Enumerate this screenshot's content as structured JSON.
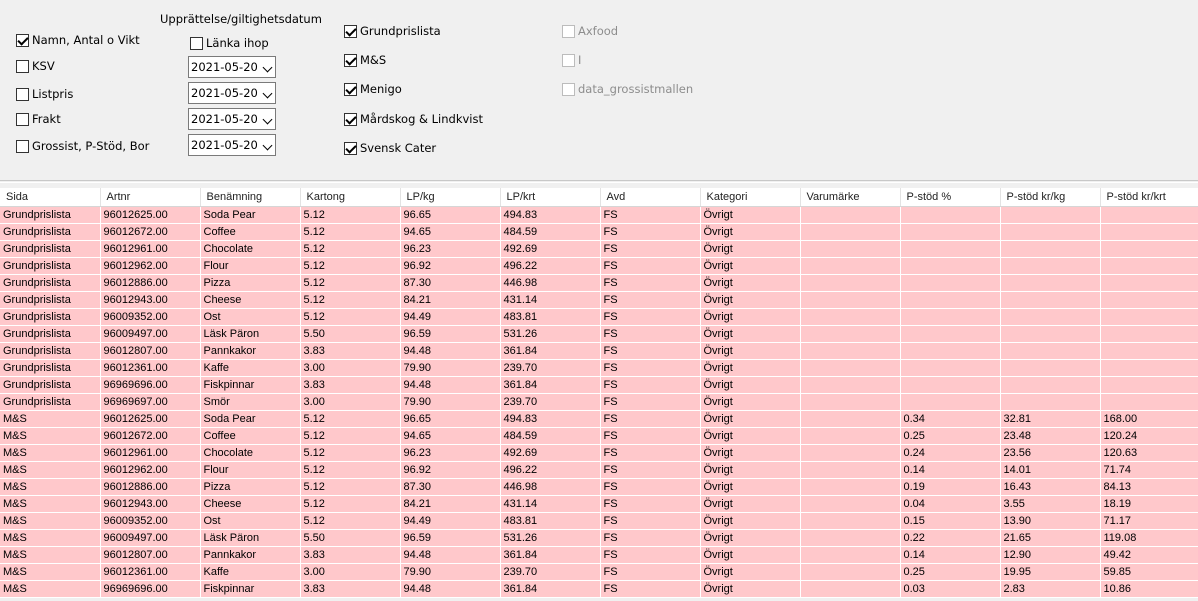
{
  "options": {
    "heading": "Upprättelse/giltighetsdatum",
    "left_checks": [
      {
        "label": "Namn, Antal o Vikt",
        "checked": true
      },
      {
        "label": "KSV",
        "checked": false
      },
      {
        "label": "Listpris",
        "checked": false
      },
      {
        "label": "Frakt",
        "checked": false
      },
      {
        "label": "Grossist, P-Stöd, Bor",
        "checked": false
      }
    ],
    "link_check": {
      "label": "Länka ihop",
      "checked": false
    },
    "dates": [
      "2021-05-20",
      "2021-05-20",
      "2021-05-20",
      "2021-05-20"
    ],
    "wholesalers": [
      {
        "label": "Grundprislista",
        "checked": true
      },
      {
        "label": "M&S",
        "checked": true
      },
      {
        "label": "Menigo",
        "checked": true
      },
      {
        "label": "Mårdskog & Lindkvist",
        "checked": true
      },
      {
        "label": "Svensk Cater",
        "checked": true
      }
    ],
    "disabled_checks": [
      {
        "label": "Axfood",
        "checked": false
      },
      {
        "label": "I",
        "checked": false
      },
      {
        "label": "data_grossistmallen",
        "checked": false
      }
    ]
  },
  "table": {
    "columns": [
      "Sida",
      "Artnr",
      "Benämning",
      "Kartong",
      "LP/kg",
      "LP/krt",
      "Avd",
      "Kategori",
      "Varumärke",
      "P-stöd %",
      "P-stöd kr/kg",
      "P-stöd kr/krt"
    ],
    "rows": [
      [
        "Grundprislista",
        "96012625.00",
        "Soda Pear",
        "5.12",
        "96.65",
        "494.83",
        "FS",
        "Övrigt",
        "",
        "",
        "",
        ""
      ],
      [
        "Grundprislista",
        "96012672.00",
        "Coffee",
        "5.12",
        "94.65",
        "484.59",
        "FS",
        "Övrigt",
        "",
        "",
        "",
        ""
      ],
      [
        "Grundprislista",
        "96012961.00",
        "Chocolate",
        "5.12",
        "96.23",
        "492.69",
        "FS",
        "Övrigt",
        "",
        "",
        "",
        ""
      ],
      [
        "Grundprislista",
        "96012962.00",
        "Flour",
        "5.12",
        "96.92",
        "496.22",
        "FS",
        "Övrigt",
        "",
        "",
        "",
        ""
      ],
      [
        "Grundprislista",
        "96012886.00",
        "Pizza",
        "5.12",
        "87.30",
        "446.98",
        "FS",
        "Övrigt",
        "",
        "",
        "",
        ""
      ],
      [
        "Grundprislista",
        "96012943.00",
        "Cheese",
        "5.12",
        "84.21",
        "431.14",
        "FS",
        "Övrigt",
        "",
        "",
        "",
        ""
      ],
      [
        "Grundprislista",
        "96009352.00",
        "Ost",
        "5.12",
        "94.49",
        "483.81",
        "FS",
        "Övrigt",
        "",
        "",
        "",
        ""
      ],
      [
        "Grundprislista",
        "96009497.00",
        "Läsk Päron",
        "5.50",
        "96.59",
        "531.26",
        "FS",
        "Övrigt",
        "",
        "",
        "",
        ""
      ],
      [
        "Grundprislista",
        "96012807.00",
        "Pannkakor",
        "3.83",
        "94.48",
        "361.84",
        "FS",
        "Övrigt",
        "",
        "",
        "",
        ""
      ],
      [
        "Grundprislista",
        "96012361.00",
        "Kaffe",
        "3.00",
        "79.90",
        "239.70",
        "FS",
        "Övrigt",
        "",
        "",
        "",
        ""
      ],
      [
        "Grundprislista",
        "96969696.00",
        "Fiskpinnar",
        "3.83",
        "94.48",
        "361.84",
        "FS",
        "Övrigt",
        "",
        "",
        "",
        ""
      ],
      [
        "Grundprislista",
        "96969697.00",
        "Smör",
        "3.00",
        "79.90",
        "239.70",
        "FS",
        "Övrigt",
        "",
        "",
        "",
        ""
      ],
      [
        "M&S",
        "96012625.00",
        "Soda Pear",
        "5.12",
        "96.65",
        "494.83",
        "FS",
        "Övrigt",
        "",
        "0.34",
        "32.81",
        "168.00"
      ],
      [
        "M&S",
        "96012672.00",
        "Coffee",
        "5.12",
        "94.65",
        "484.59",
        "FS",
        "Övrigt",
        "",
        "0.25",
        "23.48",
        "120.24"
      ],
      [
        "M&S",
        "96012961.00",
        "Chocolate",
        "5.12",
        "96.23",
        "492.69",
        "FS",
        "Övrigt",
        "",
        "0.24",
        "23.56",
        "120.63"
      ],
      [
        "M&S",
        "96012962.00",
        "Flour",
        "5.12",
        "96.92",
        "496.22",
        "FS",
        "Övrigt",
        "",
        "0.14",
        "14.01",
        "71.74"
      ],
      [
        "M&S",
        "96012886.00",
        "Pizza",
        "5.12",
        "87.30",
        "446.98",
        "FS",
        "Övrigt",
        "",
        "0.19",
        "16.43",
        "84.13"
      ],
      [
        "M&S",
        "96012943.00",
        "Cheese",
        "5.12",
        "84.21",
        "431.14",
        "FS",
        "Övrigt",
        "",
        "0.04",
        "3.55",
        "18.19"
      ],
      [
        "M&S",
        "96009352.00",
        "Ost",
        "5.12",
        "94.49",
        "483.81",
        "FS",
        "Övrigt",
        "",
        "0.15",
        "13.90",
        "71.17"
      ],
      [
        "M&S",
        "96009497.00",
        "Läsk Päron",
        "5.50",
        "96.59",
        "531.26",
        "FS",
        "Övrigt",
        "",
        "0.22",
        "21.65",
        "119.08"
      ],
      [
        "M&S",
        "96012807.00",
        "Pannkakor",
        "3.83",
        "94.48",
        "361.84",
        "FS",
        "Övrigt",
        "",
        "0.14",
        "12.90",
        "49.42"
      ],
      [
        "M&S",
        "96012361.00",
        "Kaffe",
        "3.00",
        "79.90",
        "239.70",
        "FS",
        "Övrigt",
        "",
        "0.25",
        "19.95",
        "59.85"
      ],
      [
        "M&S",
        "96969696.00",
        "Fiskpinnar",
        "3.83",
        "94.48",
        "361.84",
        "FS",
        "Övrigt",
        "",
        "0.03",
        "2.83",
        "10.86"
      ]
    ]
  },
  "colors": {
    "row_bg": "#ffc8cb",
    "panel_bg": "#f0f0f0"
  }
}
